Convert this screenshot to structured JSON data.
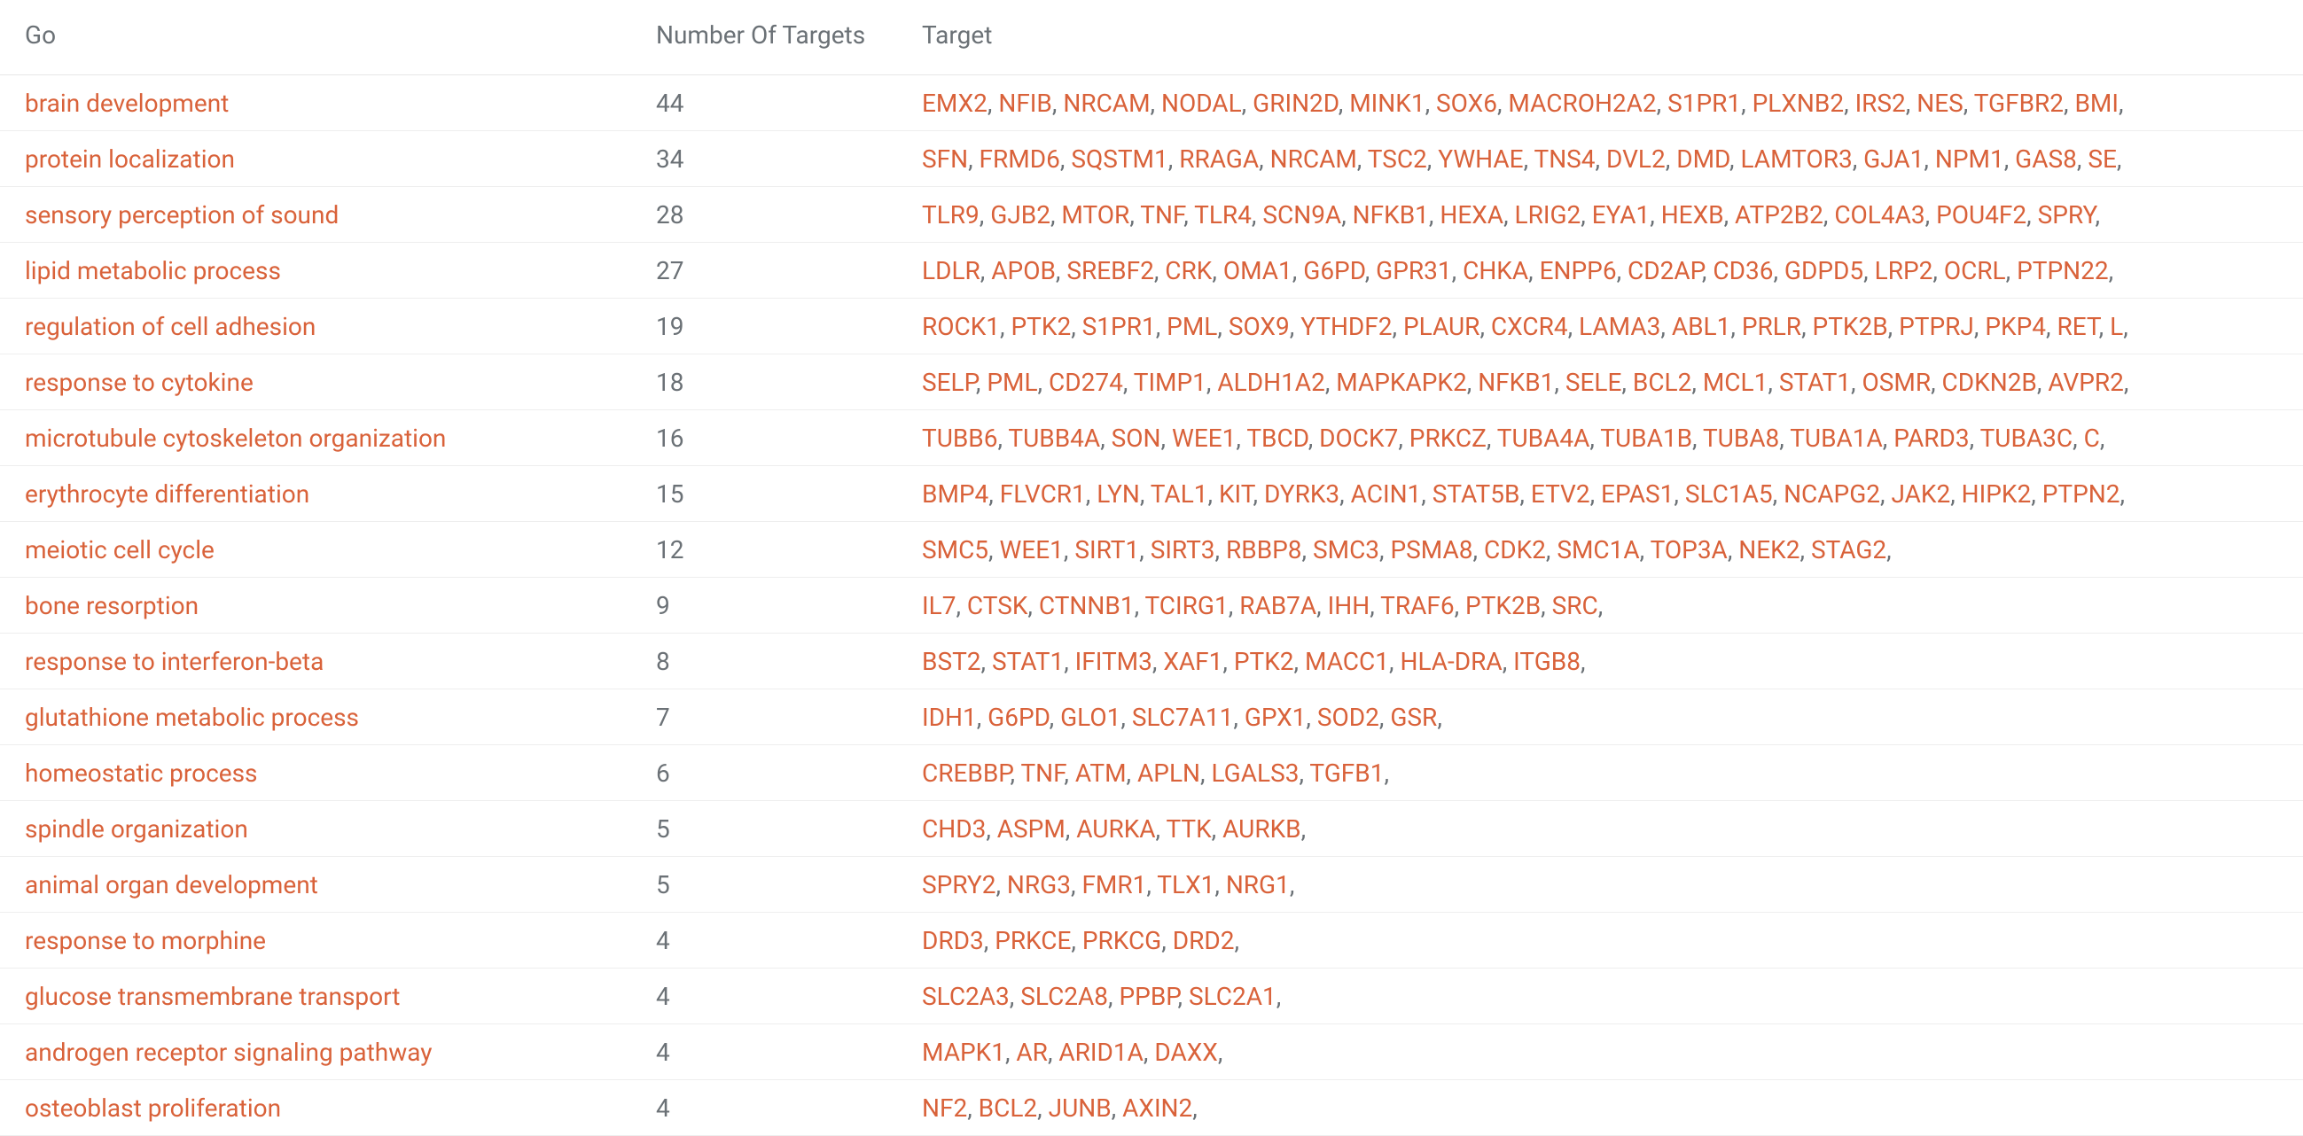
{
  "headers": {
    "go": "Go",
    "num": "Number Of Targets",
    "target": "Target"
  },
  "rows": [
    {
      "go": "brain development",
      "num": "44",
      "targets": [
        "EMX2",
        "NFIB",
        "NRCAM",
        "NODAL",
        "GRIN2D",
        "MINK1",
        "SOX6",
        "MACROH2A2",
        "S1PR1",
        "PLXNB2",
        "IRS2",
        "NES",
        "TGFBR2",
        "BMI"
      ]
    },
    {
      "go": "protein localization",
      "num": "34",
      "targets": [
        "SFN",
        "FRMD6",
        "SQSTM1",
        "RRAGA",
        "NRCAM",
        "TSC2",
        "YWHAE",
        "TNS4",
        "DVL2",
        "DMD",
        "LAMTOR3",
        "GJA1",
        "NPM1",
        "GAS8",
        "SE"
      ]
    },
    {
      "go": "sensory perception of sound",
      "num": "28",
      "targets": [
        "TLR9",
        "GJB2",
        "MTOR",
        "TNF",
        "TLR4",
        "SCN9A",
        "NFKB1",
        "HEXA",
        "LRIG2",
        "EYA1",
        "HEXB",
        "ATP2B2",
        "COL4A3",
        "POU4F2",
        "SPRY"
      ]
    },
    {
      "go": "lipid metabolic process",
      "num": "27",
      "targets": [
        "LDLR",
        "APOB",
        "SREBF2",
        "CRK",
        "OMA1",
        "G6PD",
        "GPR31",
        "CHKA",
        "ENPP6",
        "CD2AP",
        "CD36",
        "GDPD5",
        "LRP2",
        "OCRL",
        "PTPN22"
      ]
    },
    {
      "go": "regulation of cell adhesion",
      "num": "19",
      "targets": [
        "ROCK1",
        "PTK2",
        "S1PR1",
        "PML",
        "SOX9",
        "YTHDF2",
        "PLAUR",
        "CXCR4",
        "LAMA3",
        "ABL1",
        "PRLR",
        "PTK2B",
        "PTPRJ",
        "PKP4",
        "RET",
        "L"
      ]
    },
    {
      "go": "response to cytokine",
      "num": "18",
      "targets": [
        "SELP",
        "PML",
        "CD274",
        "TIMP1",
        "ALDH1A2",
        "MAPKAPK2",
        "NFKB1",
        "SELE",
        "BCL2",
        "MCL1",
        "STAT1",
        "OSMR",
        "CDKN2B",
        "AVPR2"
      ]
    },
    {
      "go": "microtubule cytoskeleton organization",
      "num": "16",
      "targets": [
        "TUBB6",
        "TUBB4A",
        "SON",
        "WEE1",
        "TBCD",
        "DOCK7",
        "PRKCZ",
        "TUBA4A",
        "TUBA1B",
        "TUBA8",
        "TUBA1A",
        "PARD3",
        "TUBA3C",
        "C"
      ]
    },
    {
      "go": "erythrocyte differentiation",
      "num": "15",
      "targets": [
        "BMP4",
        "FLVCR1",
        "LYN",
        "TAL1",
        "KIT",
        "DYRK3",
        "ACIN1",
        "STAT5B",
        "ETV2",
        "EPAS1",
        "SLC1A5",
        "NCAPG2",
        "JAK2",
        "HIPK2",
        "PTPN2"
      ]
    },
    {
      "go": "meiotic cell cycle",
      "num": "12",
      "targets": [
        "SMC5",
        "WEE1",
        "SIRT1",
        "SIRT3",
        "RBBP8",
        "SMC3",
        "PSMA8",
        "CDK2",
        "SMC1A",
        "TOP3A",
        "NEK2",
        "STAG2"
      ]
    },
    {
      "go": "bone resorption",
      "num": "9",
      "targets": [
        "IL7",
        "CTSK",
        "CTNNB1",
        "TCIRG1",
        "RAB7A",
        "IHH",
        "TRAF6",
        "PTK2B",
        "SRC"
      ]
    },
    {
      "go": "response to interferon-beta",
      "num": "8",
      "targets": [
        "BST2",
        "STAT1",
        "IFITM3",
        "XAF1",
        "PTK2",
        "MACC1",
        "HLA-DRA",
        "ITGB8"
      ]
    },
    {
      "go": "glutathione metabolic process",
      "num": "7",
      "targets": [
        "IDH1",
        "G6PD",
        "GLO1",
        "SLC7A11",
        "GPX1",
        "SOD2",
        "GSR"
      ]
    },
    {
      "go": "homeostatic process",
      "num": "6",
      "targets": [
        "CREBBP",
        "TNF",
        "ATM",
        "APLN",
        "LGALS3",
        "TGFB1"
      ]
    },
    {
      "go": "spindle organization",
      "num": "5",
      "targets": [
        "CHD3",
        "ASPM",
        "AURKA",
        "TTK",
        "AURKB"
      ]
    },
    {
      "go": "animal organ development",
      "num": "5",
      "targets": [
        "SPRY2",
        "NRG3",
        "FMR1",
        "TLX1",
        "NRG1"
      ]
    },
    {
      "go": "response to morphine",
      "num": "4",
      "targets": [
        "DRD3",
        "PRKCE",
        "PRKCG",
        "DRD2"
      ]
    },
    {
      "go": "glucose transmembrane transport",
      "num": "4",
      "targets": [
        "SLC2A3",
        "SLC2A8",
        "PPBP",
        "SLC2A1"
      ]
    },
    {
      "go": "androgen receptor signaling pathway",
      "num": "4",
      "targets": [
        "MAPK1",
        "AR",
        "ARID1A",
        "DAXX"
      ]
    },
    {
      "go": "osteoblast proliferation",
      "num": "4",
      "targets": [
        "NF2",
        "BCL2",
        "JUNB",
        "AXIN2"
      ]
    }
  ]
}
